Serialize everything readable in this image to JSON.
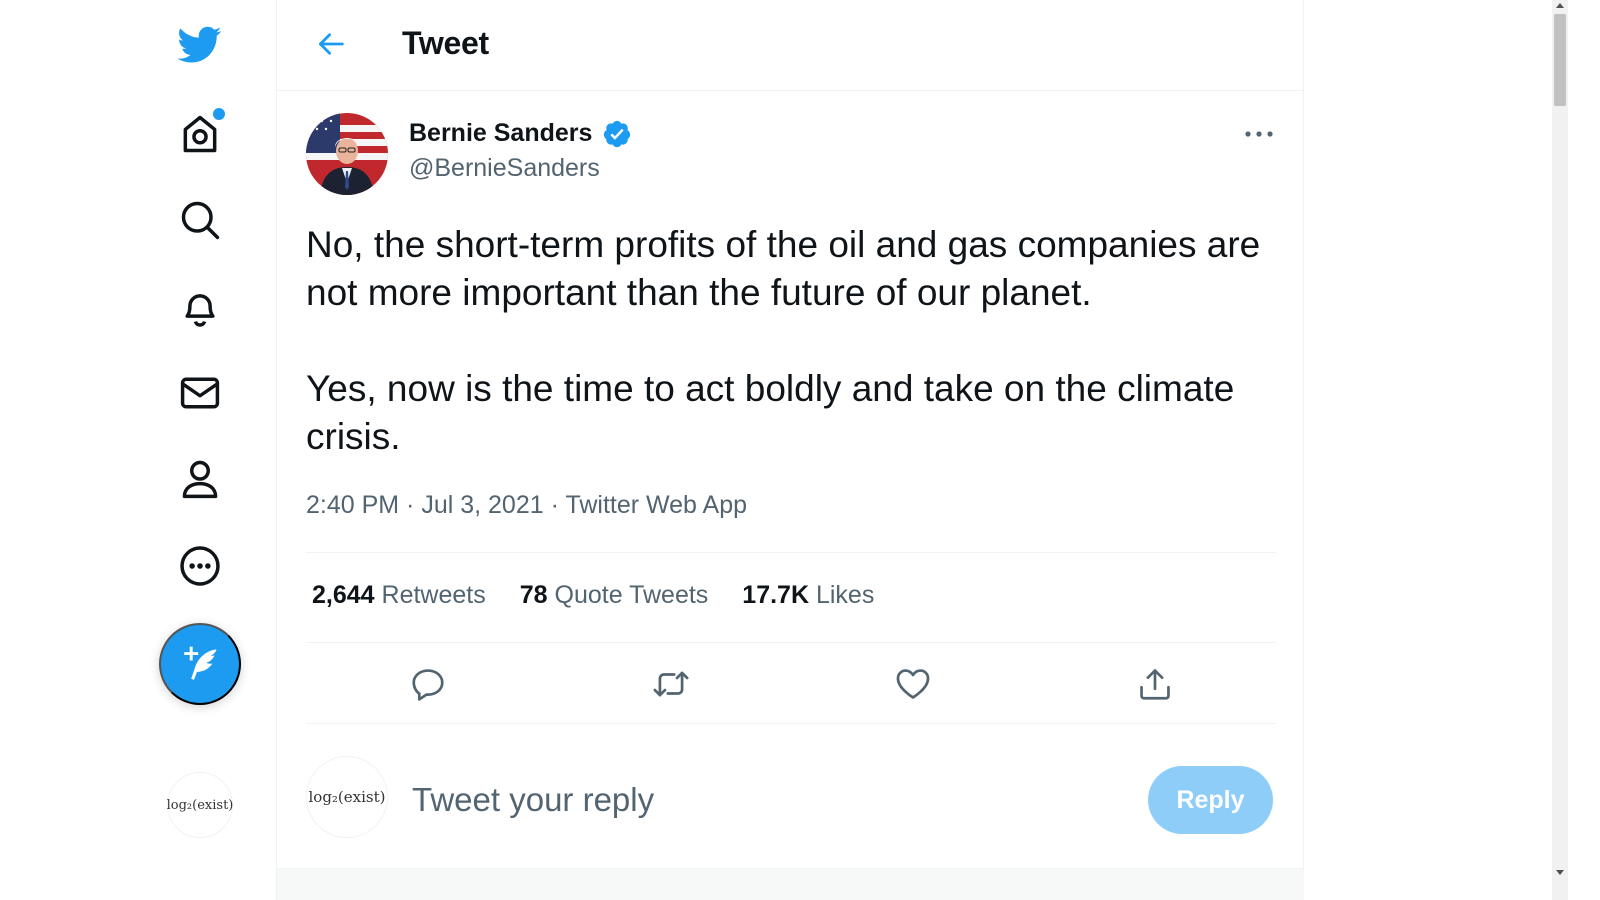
{
  "nav": {
    "logo_icon": "twitter-bird-icon",
    "items": [
      {
        "name": "home",
        "icon": "home-icon",
        "has_notification": true
      },
      {
        "name": "explore",
        "icon": "search-icon"
      },
      {
        "name": "notifications",
        "icon": "bell-icon"
      },
      {
        "name": "messages",
        "icon": "mail-icon"
      },
      {
        "name": "profile",
        "icon": "person-icon"
      },
      {
        "name": "more",
        "icon": "more-circle-icon"
      }
    ],
    "compose_icon": "compose-feather-icon",
    "account_avatar_text": "log₂(exist)"
  },
  "header": {
    "title": "Tweet",
    "back_icon": "arrow-left-icon"
  },
  "tweet": {
    "author_name": "Bernie Sanders",
    "verified": true,
    "handle": "@BernieSanders",
    "text_paragraphs": [
      "No, the short-term profits of the oil and gas companies are not more important than the future of our planet.",
      "Yes, now is the time to act boldly and take on the climate crisis."
    ],
    "time": "2:40 PM",
    "date": "Jul 3, 2021",
    "source": "Twitter Web App",
    "stats": {
      "retweets_count": "2,644",
      "retweets_label": "Retweets",
      "quotes_count": "78",
      "quotes_label": "Quote Tweets",
      "likes_count": "17.7K",
      "likes_label": "Likes"
    },
    "actions": [
      "reply-icon",
      "retweet-icon",
      "like-icon",
      "share-icon"
    ]
  },
  "reply": {
    "avatar_text": "log₂(exist)",
    "placeholder": "Tweet your reply",
    "button_label": "Reply"
  },
  "colors": {
    "accent": "#1d9bf0",
    "text_primary": "#0f1419",
    "text_secondary": "#536471",
    "border": "#eff3f4",
    "reply_button_disabled": "#8ecdf8"
  }
}
